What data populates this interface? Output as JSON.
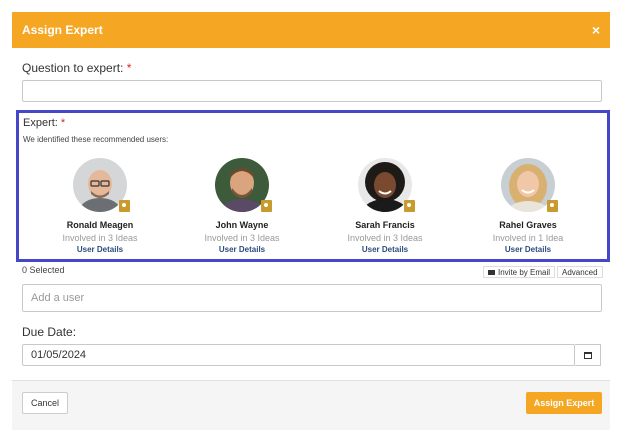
{
  "dialog": {
    "title": "Assign Expert",
    "close_glyph": "×"
  },
  "question": {
    "label": "Question to expert:",
    "required_mark": "*",
    "value": ""
  },
  "expert": {
    "label": "Expert:",
    "required_mark": "*",
    "subtitle": "We identified these recommended users:",
    "users": [
      {
        "name": "Ronald Meagen",
        "ideas": "Involved in 3 Ideas",
        "details": "User Details"
      },
      {
        "name": "John Wayne",
        "ideas": "Involved in 3 Ideas",
        "details": "User Details"
      },
      {
        "name": "Sarah Francis",
        "ideas": "Involved in 3 Ideas",
        "details": "User Details"
      },
      {
        "name": "Rahel Graves",
        "ideas": "Involved in 1 Idea",
        "details": "User Details"
      }
    ]
  },
  "selection": {
    "count_text": "0 Selected",
    "invite_label": "Invite by Email",
    "advanced_label": "Advanced",
    "add_user_placeholder": "Add a user"
  },
  "due_date": {
    "label": "Due Date:",
    "value": "01/05/2024"
  },
  "footer": {
    "cancel_label": "Cancel",
    "assign_label": "Assign Expert"
  },
  "colors": {
    "accent": "#f5a623",
    "highlight_border": "#4646c8",
    "required": "#d9251d",
    "link": "#2b4c7e",
    "badge": "#c99a2e"
  },
  "icons": {
    "close": "close-icon",
    "badge": "award-badge-icon",
    "invite": "envelope-icon",
    "date": "calendar-icon"
  }
}
